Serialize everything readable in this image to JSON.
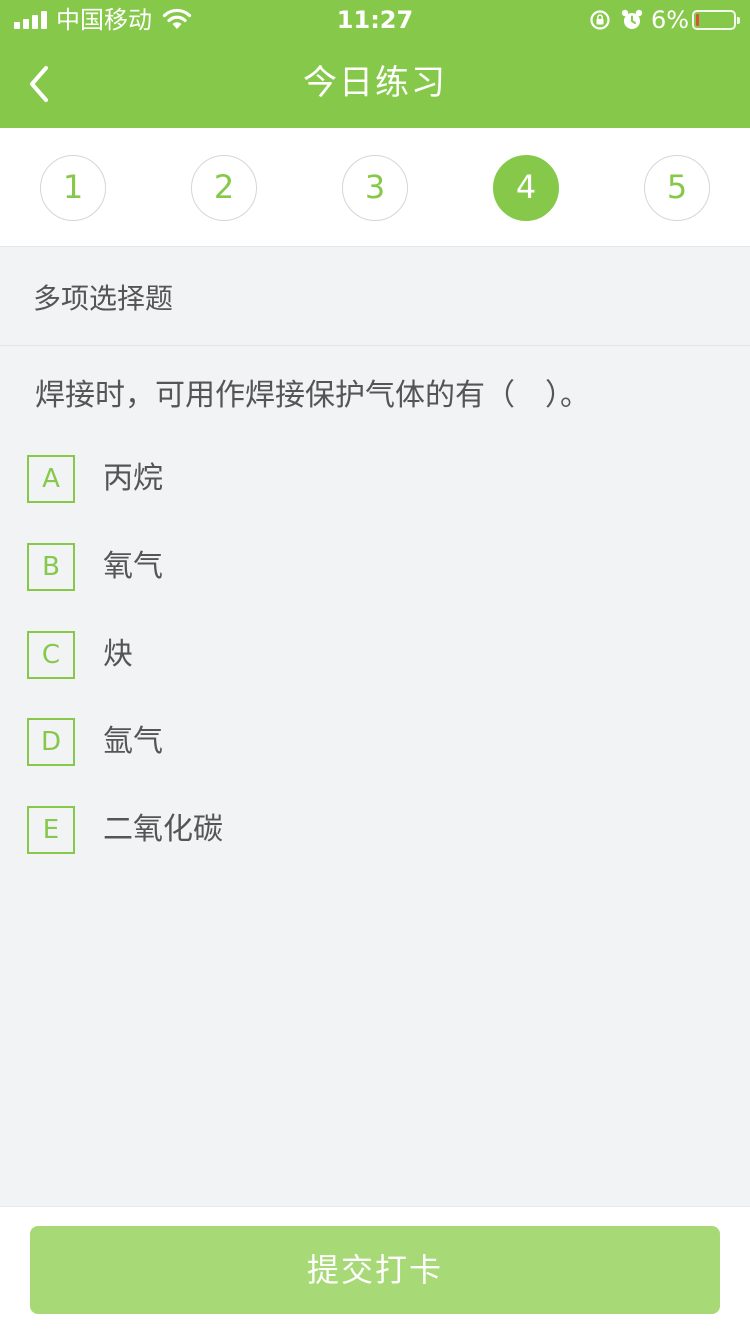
{
  "status": {
    "carrier": "中国移动",
    "time": "11:27",
    "battery_pct": "6%"
  },
  "nav": {
    "back_icon": "chevron-left-icon",
    "title": "今日练习"
  },
  "steps": [
    "1",
    "2",
    "3",
    "4",
    "5"
  ],
  "active_step": "4",
  "question": {
    "type": "多项选择题",
    "text": "焊接时，可用作焊接保护气体的有（　）。",
    "options": [
      {
        "letter": "A",
        "text": "丙烷"
      },
      {
        "letter": "B",
        "text": "氧气"
      },
      {
        "letter": "C",
        "text": "炔"
      },
      {
        "letter": "D",
        "text": "氩气"
      },
      {
        "letter": "E",
        "text": "二氧化碳"
      }
    ]
  },
  "footer": {
    "submit_label": "提交打卡"
  },
  "colors": {
    "brand": "#86c94a",
    "button_disabled": "#a7da76"
  }
}
